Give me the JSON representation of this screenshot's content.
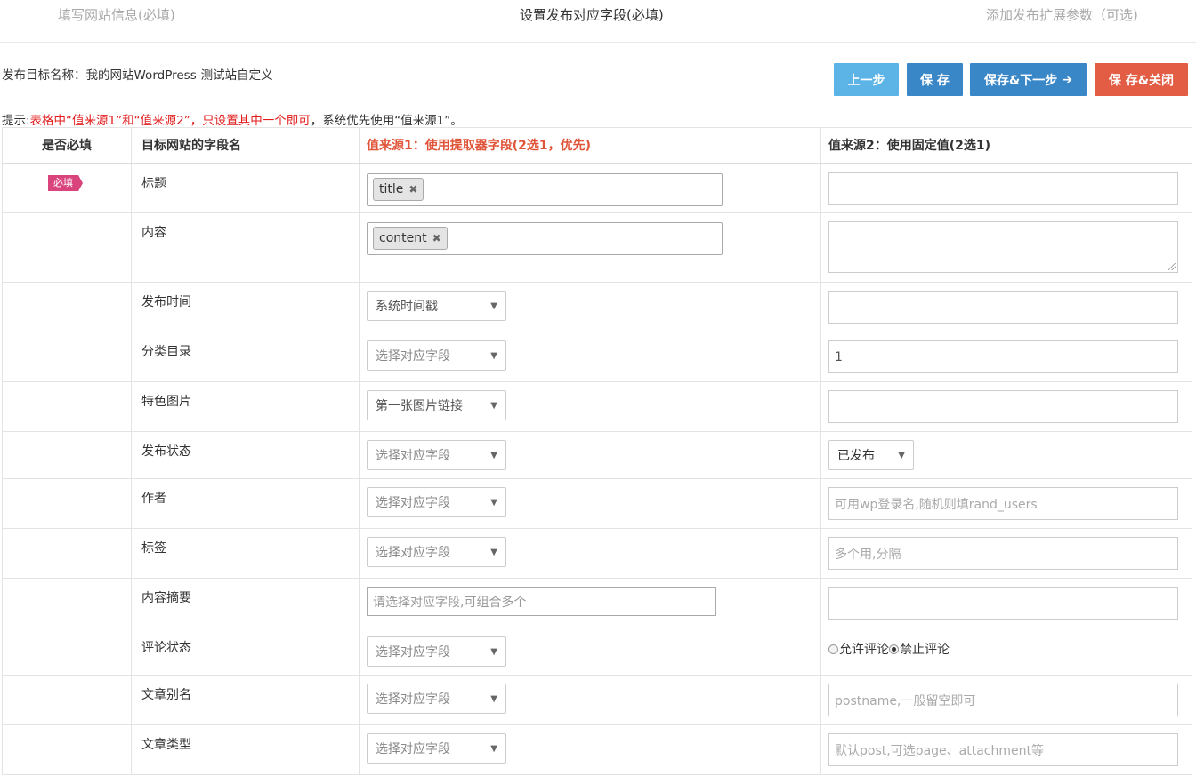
{
  "steps": [
    {
      "label": "填写网站信息(必填)",
      "state": "inactive"
    },
    {
      "label": "设置发布对应字段(必填)",
      "state": "active"
    },
    {
      "label": "添加发布扩展参数（可选)",
      "state": "inactive"
    }
  ],
  "target": {
    "label": "发布目标名称：",
    "value": "我的网站WordPress-测试站自定义"
  },
  "buttons": {
    "prev": "上一步",
    "save": "保 存",
    "save_next": "保存&下一步",
    "save_close": "保 存&关闭"
  },
  "tip": {
    "prefix": "提示:",
    "red": "表格中“值来源1”和“值来源2”，只设置其中一个即可",
    "suffix": "，系统优先使用“值来源1”。"
  },
  "table": {
    "headers": [
      "是否必填",
      "目标网站的字段名",
      "值来源1：使用提取器字段(2选1，优先)",
      "值来源2：使用固定值(2选1)"
    ],
    "required_badge": "必填",
    "rows": [
      {
        "field": "标题",
        "tag": "title",
        "fixed_value": ""
      },
      {
        "field": "内容",
        "tag": "content",
        "fixed_value": ""
      },
      {
        "field": "发布时间",
        "select": "系统时间戳",
        "fixed_value": ""
      },
      {
        "field": "分类目录",
        "select": "选择对应字段",
        "fixed_value": "1"
      },
      {
        "field": "特色图片",
        "select": "第一张图片链接",
        "fixed_value": ""
      },
      {
        "field": "发布状态",
        "select": "选择对应字段",
        "fixed_select": "已发布"
      },
      {
        "field": "作者",
        "select": "选择对应字段",
        "placeholder": "可用wp登录名,随机则填rand_users"
      },
      {
        "field": "标签",
        "select": "选择对应字段",
        "placeholder": "多个用,分隔"
      },
      {
        "field": "内容摘要",
        "input_placeholder": "请选择对应字段,可组合多个",
        "fixed_value": ""
      },
      {
        "field": "评论状态",
        "select": "选择对应字段",
        "radios": [
          {
            "label": "允许评论",
            "checked": false
          },
          {
            "label": "禁止评论",
            "checked": true
          }
        ]
      },
      {
        "field": "文章别名",
        "select": "选择对应字段",
        "placeholder": "postname,一般留空即可"
      },
      {
        "field": "文章类型",
        "select": "选择对应字段",
        "placeholder": "默认post,可选page、attachment等"
      }
    ]
  }
}
